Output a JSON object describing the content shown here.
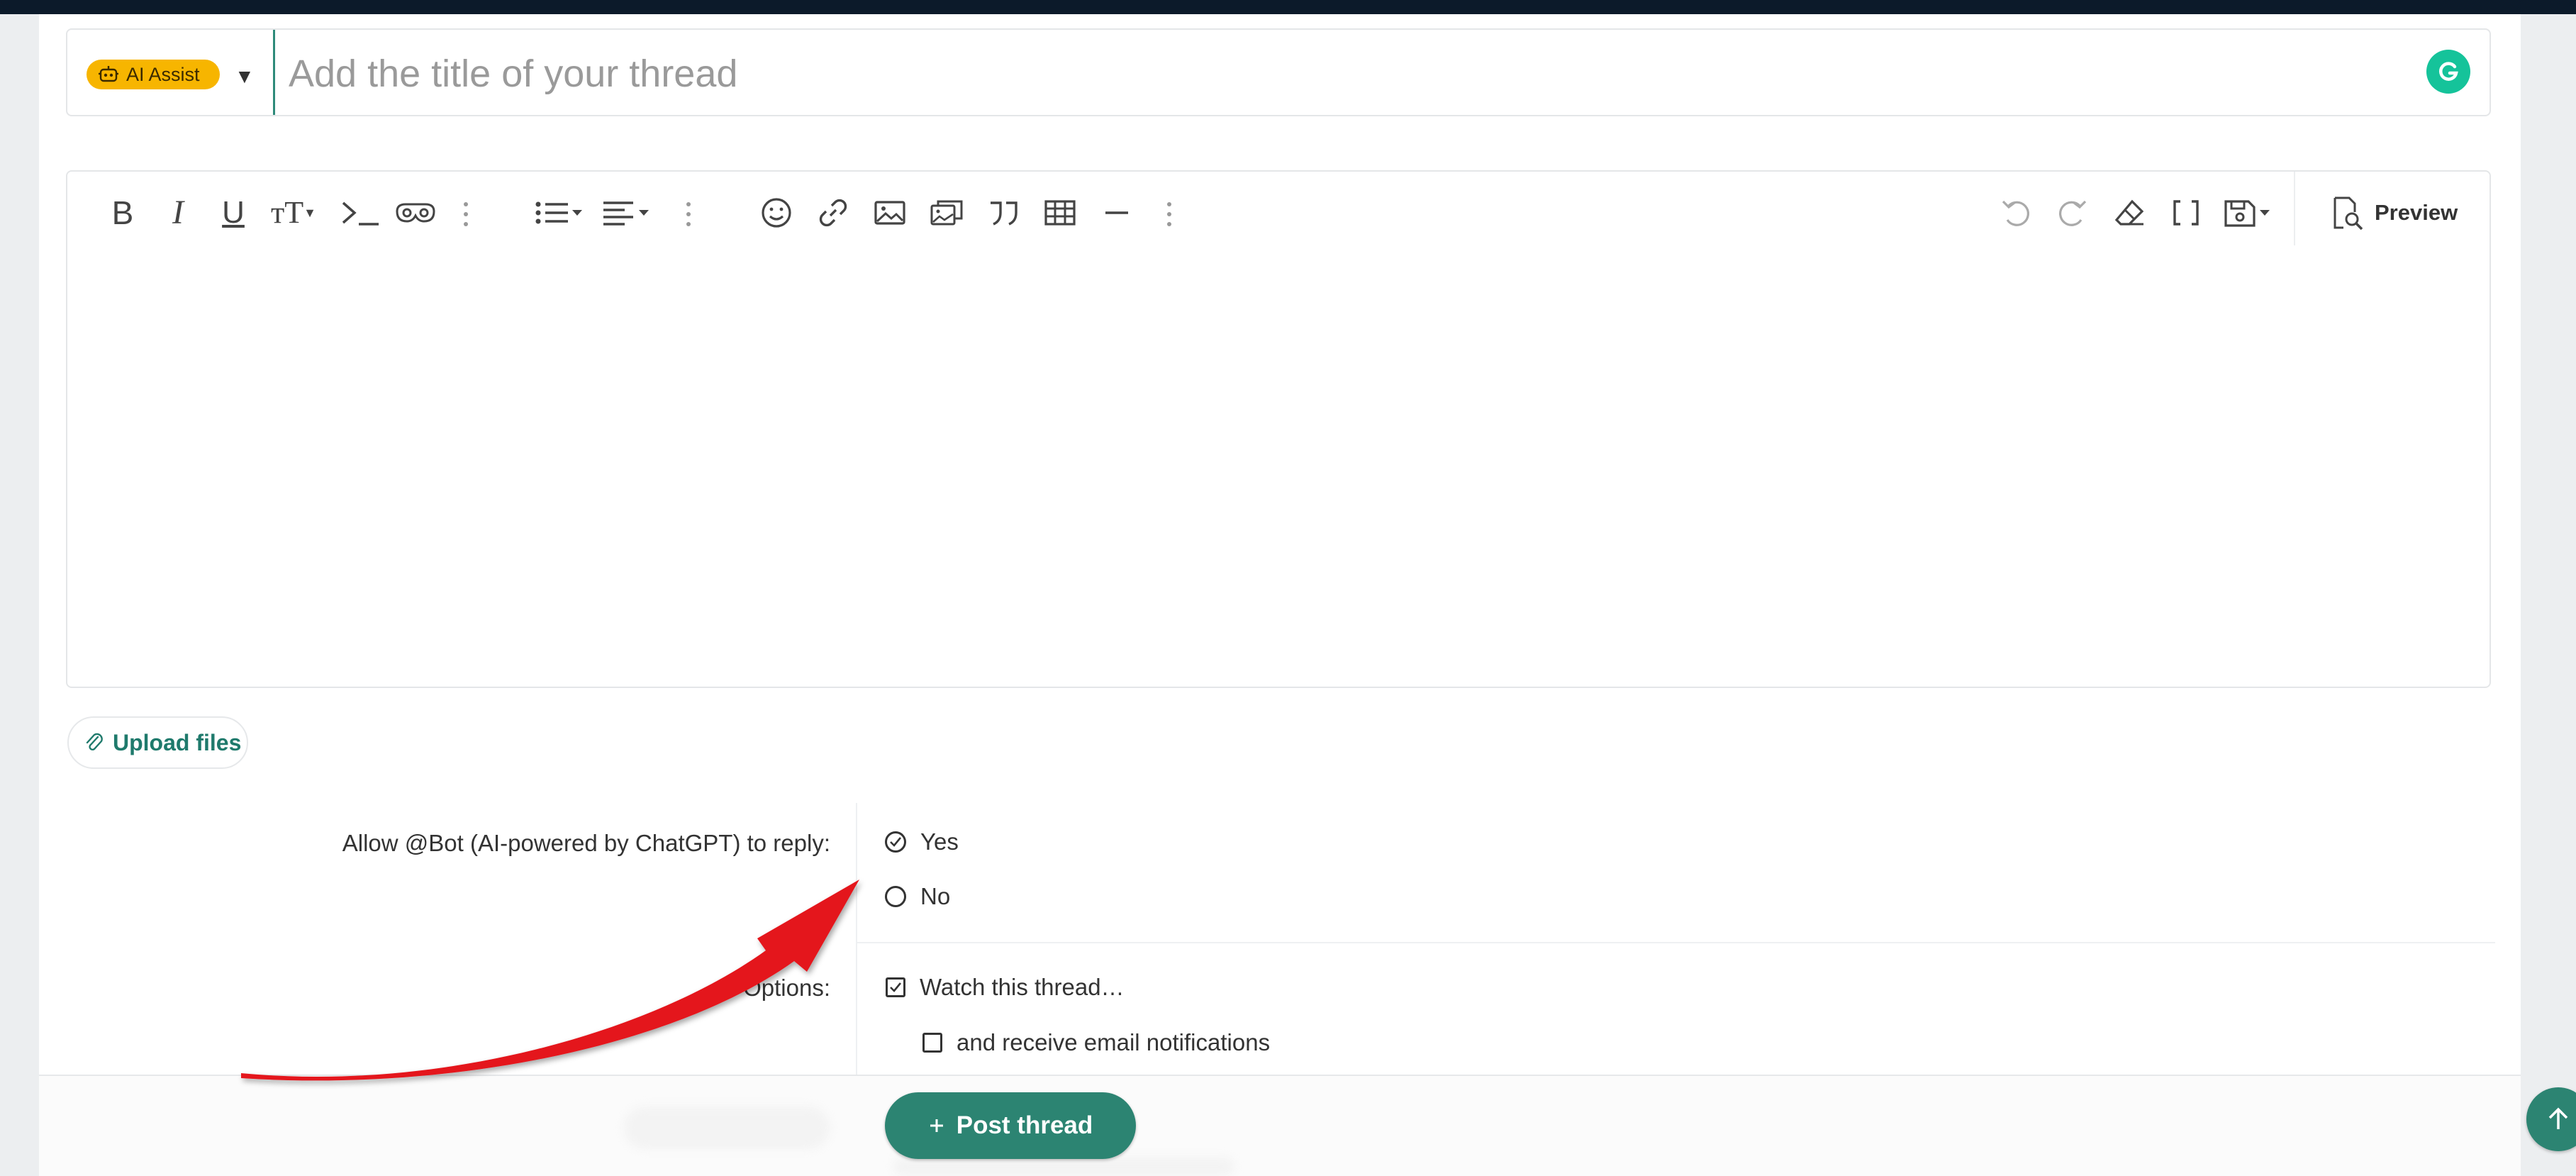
{
  "title_bar": {
    "ai_assist_label": "AI Assist",
    "title_placeholder": "Add the title of your thread"
  },
  "editor": {
    "toolbar": {
      "left": [
        "bold-icon",
        "italic-icon",
        "underline-icon",
        "font-size-icon",
        "code-icon",
        "spoiler-icon",
        "more-icon",
        "list-icon",
        "align-icon",
        "more-icon",
        "emoji-icon",
        "link-icon",
        "image-icon",
        "media-icon",
        "quote-icon",
        "table-icon",
        "horizontal-rule-icon",
        "more-icon"
      ],
      "right": [
        "undo-icon",
        "redo-icon",
        "eraser-icon",
        "bbcode-icon",
        "drafts-icon"
      ]
    },
    "preview_label": "Preview"
  },
  "upload": {
    "label": "Upload files"
  },
  "bot_reply": {
    "label": "Allow @Bot (AI-powered by ChatGPT) to reply:",
    "options": [
      {
        "label": "Yes",
        "selected": true
      },
      {
        "label": "No",
        "selected": false
      }
    ]
  },
  "options": {
    "label": "Options:",
    "watch_label": "Watch this thread…",
    "watch_checked": true,
    "email_label": "and receive email notifications",
    "email_checked": false
  },
  "footer": {
    "post_label": "Post thread"
  },
  "colors": {
    "accent": "#2c8472",
    "ai_pill": "#f7b500",
    "grammarly": "#15c39a",
    "annotation_arrow": "#e4141b"
  }
}
